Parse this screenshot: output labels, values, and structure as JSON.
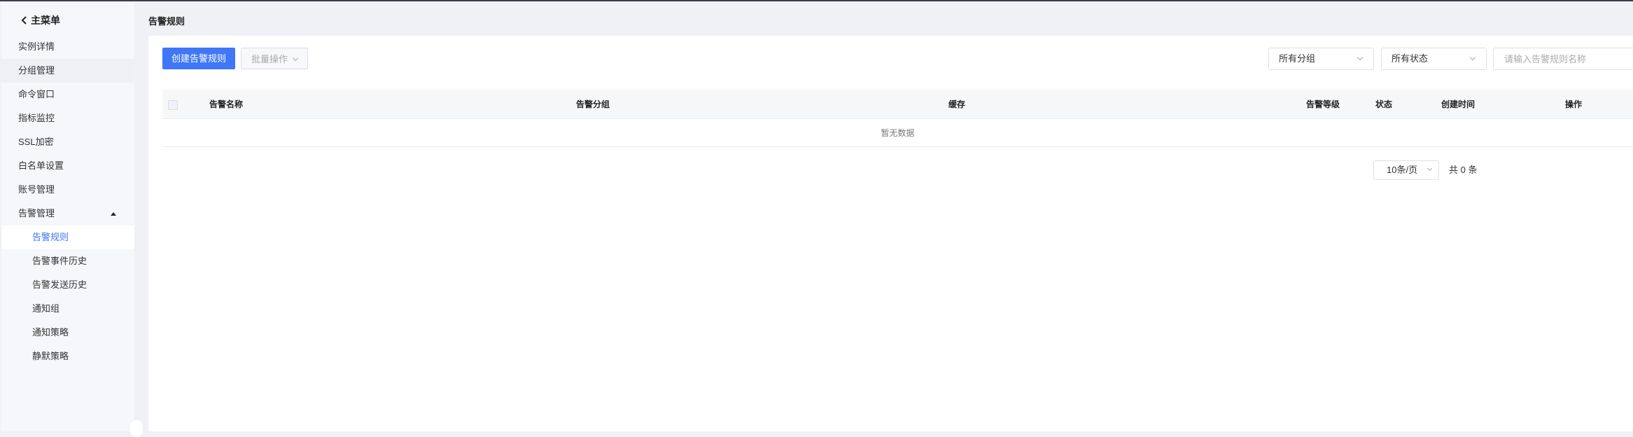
{
  "sidebar": {
    "back_label": "主菜单",
    "items": [
      "实例详情",
      "分组管理",
      "命令窗口",
      "指标监控",
      "SSL加密",
      "白名单设置",
      "账号管理",
      "告警管理"
    ],
    "sub_items": [
      "告警规则",
      "告警事件历史",
      "告警发送历史",
      "通知组",
      "通知策略",
      "静默策略"
    ]
  },
  "header": {
    "title": "告警规则"
  },
  "toolbar": {
    "create_label": "创建告警规则",
    "batch_label": "批量操作",
    "group_select": "所有分组",
    "status_select": "所有状态",
    "search_placeholder": "请输入告警规则名称"
  },
  "table": {
    "columns": [
      "告警名称",
      "告警分组",
      "缓存",
      "告警等级",
      "状态",
      "创建时间",
      "操作"
    ],
    "empty_text": "暂无数据"
  },
  "pagination": {
    "page_size": "10条/页",
    "total": "共 0 条"
  },
  "colors": {
    "accent": "#3f77f6"
  }
}
